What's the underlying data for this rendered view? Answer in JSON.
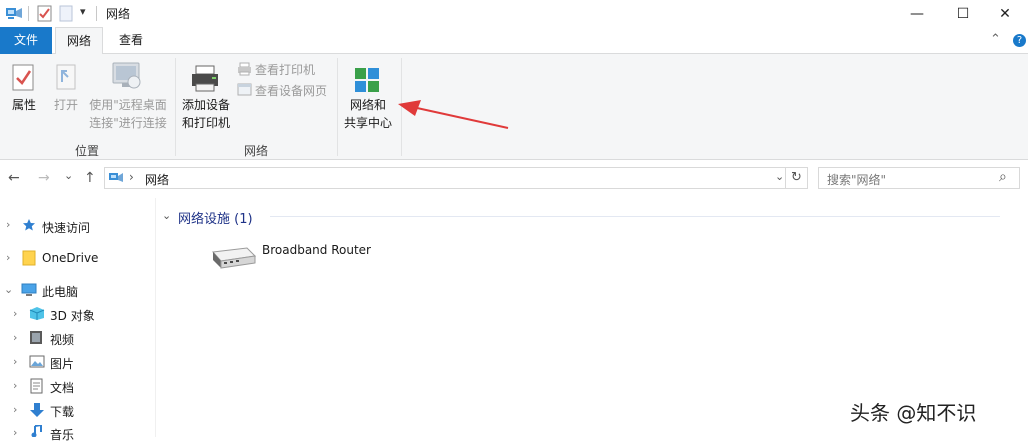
{
  "window": {
    "title": "网络",
    "minimize_glyph": "—",
    "maximize_glyph": "☐",
    "close_glyph": "✕"
  },
  "qat": {
    "dropdown_glyph": "▾"
  },
  "tabs": [
    {
      "label": "文件"
    },
    {
      "label": "网络"
    },
    {
      "label": "查看"
    }
  ],
  "ribbon": {
    "collapse_glyph": "⌃",
    "help_glyph": "?",
    "location_group": {
      "label": "位置",
      "properties": "属性",
      "open": "打开",
      "remote_desktop_line1": "使用\"远程桌面",
      "remote_desktop_line2": "连接\"进行连接"
    },
    "network_group": {
      "label": "网络",
      "add_device_line1": "添加设备",
      "add_device_line2": "和打印机",
      "view_printers": "查看打印机",
      "view_device_page": "查看设备网页",
      "center_line1": "网络和",
      "center_line2": "共享中心"
    }
  },
  "navigation": {
    "back": "←",
    "forward": "→",
    "recent": "⌄",
    "up": "↑",
    "path_separator": "›",
    "path": "网络",
    "dropdown": "⌄",
    "refresh": "↻",
    "search_placeholder": "搜索\"网络\"",
    "search_glyph": "⌕"
  },
  "nav_pane": [
    {
      "label": "快速访问",
      "expander": "›"
    },
    {
      "label": "OneDrive",
      "expander": "›"
    },
    {
      "label": "此电脑",
      "expander": "⌄"
    },
    {
      "label": "3D 对象",
      "expander": "›"
    },
    {
      "label": "视频",
      "expander": "›"
    },
    {
      "label": "图片",
      "expander": "›"
    },
    {
      "label": "文档",
      "expander": "›"
    },
    {
      "label": "下载",
      "expander": "›"
    },
    {
      "label": "音乐",
      "expander": "›"
    }
  ],
  "content": {
    "group_header": "网络设施 (1)",
    "group_chevron": "⌄",
    "device_name": "Broadband Router"
  },
  "watermark": "头条 @知不识",
  "colors": {
    "file_tab": "#1979ca",
    "ribbon_bg": "#f5f6f7",
    "group_header": "#1e3287",
    "arrow": "#e03a3a"
  }
}
